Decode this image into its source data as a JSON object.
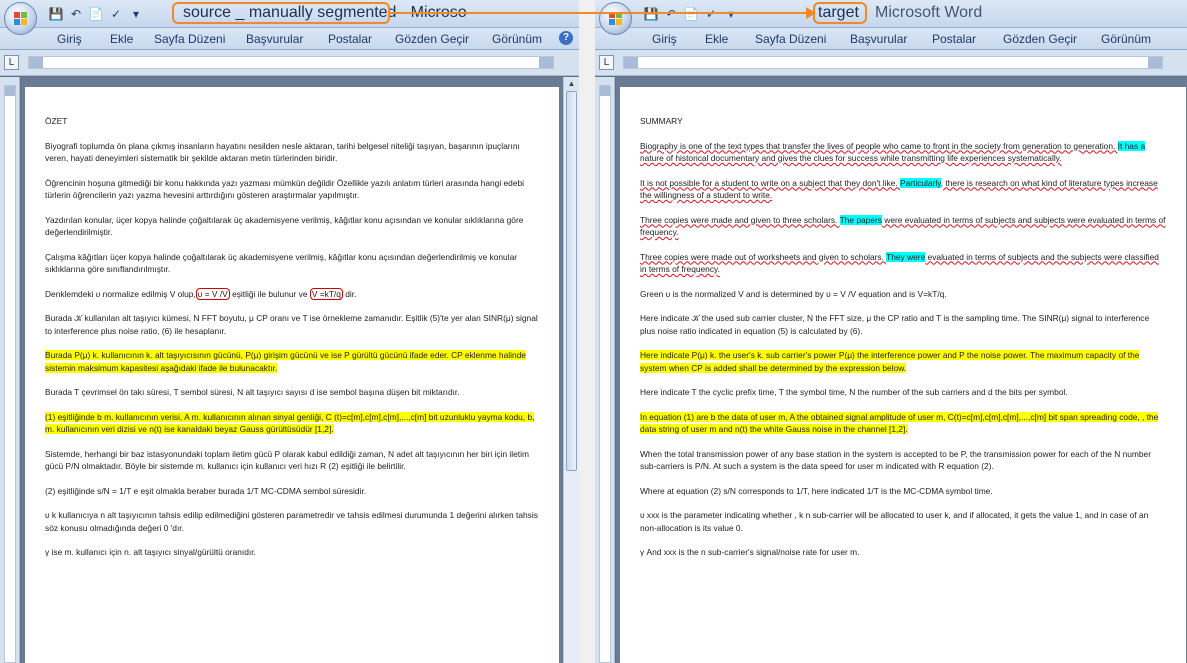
{
  "colors": {
    "annotation": "#f08a25",
    "highlight_yellow": "#ffff00",
    "highlight_cyan": "#00ffff",
    "formula_box": "#cc0000"
  },
  "left": {
    "title": "source _ manually segmented - Microso",
    "tabs": [
      "Giriş",
      "Ekle",
      "Sayfa Düzeni",
      "Başvurular",
      "Postalar",
      "Gözden Geçir",
      "Görünüm"
    ],
    "heading": "ÖZET",
    "p1": "Biyografi toplumda ön plana çıkmış insanların hayatını nesilden nesle aktaran, tarihi belgesel niteliği taşıyan, başarının ipuçlarını veren, hayati deneyimleri sistematik bir şekilde aktaran metin türlerinden biridir.",
    "p2": "Öğrencinin hoşuna gitmediği bir konu hakkında yazı yazması mümkün değildir Özellikle yazılı anlatım türleri arasında hangi edebi türlerin öğrencilerin yazı yazma hevesini arttırdığını gösteren araştırmalar yapılmıştır.",
    "p3": "Yazdırılan konular, üçer kopya halinde çoğaltılarak üç akademisyene verilmiş, kâğıtlar konu açısından ve konular sıklıklarına göre değerlendirilmiştir.",
    "p4": "Çalışma kâğıtları üçer kopya halinde çoğaltılarak üç akademisyene verilmiş, kâğıtlar konu açısından değerlendirilmiş ve konular sıklıklarına göre sınıflandırılmıştır.",
    "p5a": "Denklemdeki ",
    "p5b": "υ",
    "p5c": " normalize edilmiş V",
    "p5d": " olup,",
    "p5e": "υ = V /V",
    "p5f": " eşitliği ile bulunur ve ",
    "p5g": "V =kT/q",
    "p5h": " dir.",
    "p6": "Burada 𝒦 kullanılan alt taşıyıcı kümesi, N FFT boyutu, μ CP oranı ve T ise örneklemе zamanıdır. Eşitlik (5)'te yer alan SINR(μ) signal to interference plus noise ratio, (6) ile hesaplanır.",
    "p7": "Burada P(μ) k. kullanıcının k. alt taşıyıcısının gücünü, P(μ) girişim gücünü ve ise P gürültü gücünü ifade eder. CP eklenme halinde sistemin maksimum kapasitesi aşağıdaki ifade ile bulunacaktır.",
    "p8": "Burada T çevrimsel ön takı süresi, T sembol süresi, N alt taşıyıcı sayısı d ise sembol başına düşen bit miktarıdır.",
    "p9": "(1) eşitliğinde b m. kullanıcının verisi, A m. kullanıcının alınan sinyal genliği, C (t)=c[m],c[m],c[m],...,c[m] bit uzunluklu yayma kodu, b, m. kullanıcının veri dizisi ve n(t) ise kanaldaki beyaz Gauss gürültüsüdür [1,2].",
    "p10": "Sistemde, herhangi bir baz istasyonundaki toplam iletim gücü P olarak kabul edildiği zaman, N adet alt taşıyıcının her biri için iletim gücü P/N olmaktadır. Böyle bir sistemde m. kullanıcı için kullanıcı veri hızı R (2) eşitliği ile belirtilir.",
    "p11": "(2) eşitliğinde s/N = 1/T e eşit olmakla beraber burada 1/T MC-CDMA sembol süresidir.",
    "p12": "υ k kullanıcıya n alt taşıyıcının tahsis edilip edilmediğini gösteren parametredir ve tahsis edilmesi durumunda 1 değerini alırken tahsis söz konusu olmadığında değeri 0 'dır.",
    "p13": "γ ise m. kullanıcı için n. alt taşıyıcı sinyal/gürültü oranıdır."
  },
  "right": {
    "title": "target",
    "app": "Microsoft Word",
    "tabs": [
      "Giriş",
      "Ekle",
      "Sayfa Düzeni",
      "Başvurular",
      "Postalar",
      "Gözden Geçir",
      "Görünüm"
    ],
    "heading": "SUMMARY",
    "p1a": "Biography is one of the text types that transfer the lives of people who came to front in the society from generation to generation. ",
    "p1b": "It has a",
    "p1c": " nature of historical documentary and gives the clues for success while transmitting life experiences systematically.",
    "p2a": "It is not possible for a student to write on a subject that they don't like. ",
    "p2b": "Particularly",
    "p2c": ", there is research on what kind of literature types increase the willingness of a student to write.",
    "p3a": "Three copies were made and given to three scholars. ",
    "p3b": "The papers",
    "p3c": " were evaluated in terms of subjects and subjects were evaluated in terms of frequency.",
    "p4a": "Three copies were made out of worksheets and given to scholars. ",
    "p4b": "They were",
    "p4c": " evaluated in terms of subjects and the subjects were classified in terms of frequency.",
    "p5": "Green υ is the normalized V and is determined by υ = V /V equation and is V=kT/q.",
    "p6": "Here indicate 𝒦 the used sub carrier cluster, N the FFT size, μ the CP ratio and T is the sampling time. The SINR(μ) signal to interference plus noise ratio indicated in equation (5) is calculated by (6).",
    "p7": "Here indicate P(μ) k. the user's k. sub carrier's power P(μ) the interference power and P the noise power. The maximum capacity of the system when CP is added shall be determined by the expression below.",
    "p8": "Here indicate T the cyclic prefix time, T the symbol time, N the number of the sub carriers and d the bits per symbol.",
    "p9": "In equation (1) are b the data of user m, A the obtained signal amplitude of user m, C(t)=c[m],c[m],c[m],...,c[m] bit span spreading code, , the data string of user m and n(t) the white Gauss noise in the channel [1,2].",
    "p10": "When the total transmission power of any base station in the system is accepted to be P, the transmission power for each of the N number sub-carriers is P/N. At such a system is the data speed for user m indicated with R equation (2).",
    "p11": "Where at equation (2) s/N corresponds to 1/T, here indicated 1/T is the MC-CDMA symbol time.",
    "p12": "υ xxx is the parameter indicating whether , k n sub-carrier will be allocated to user k, and if allocated, it gets the value 1, and in case of an non-allocation is its value 0.",
    "p13": "γ And xxx is the n sub-carrier's signal/noise rate for user m."
  }
}
